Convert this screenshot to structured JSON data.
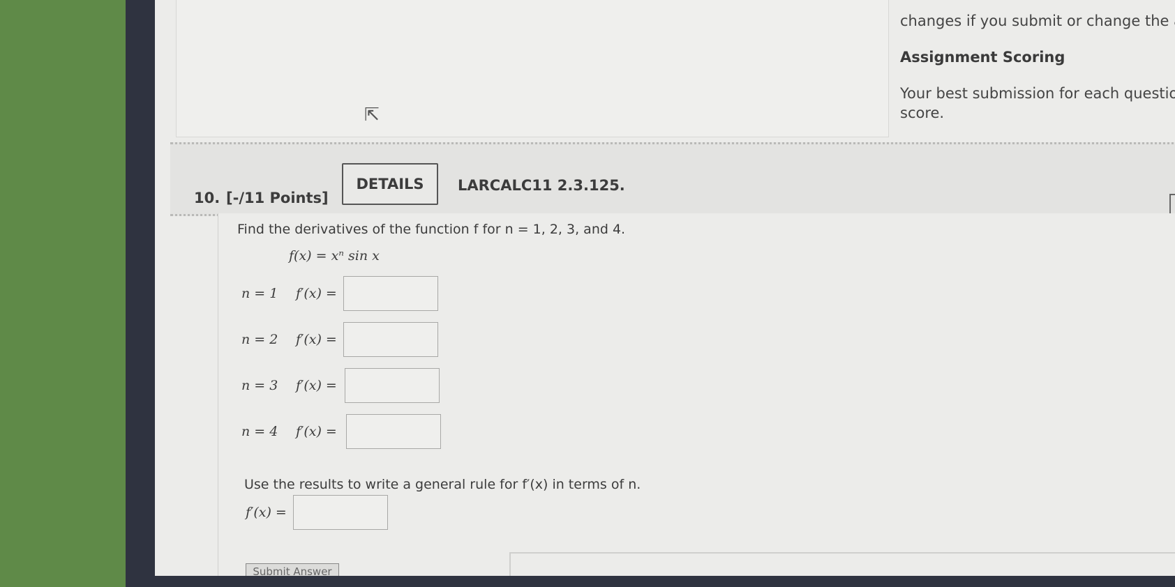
{
  "info": {
    "line1": "changes if you submit or change the an",
    "heading": "Assignment Scoring",
    "line2": "Your best submission for each question",
    "line3": "score."
  },
  "question": {
    "number": "10.",
    "points": "[-/11 Points]",
    "details_label": "DETAILS",
    "code": "LARCALC11 2.3.125.",
    "prompt": "Find the derivatives of the function f for n = 1, 2, 3, and 4.",
    "function": "f(x) = xⁿ sin x",
    "rows": [
      {
        "n_label": "n = 1",
        "deriv_label": "f′(x) ="
      },
      {
        "n_label": "n = 2",
        "deriv_label": "f′(x) ="
      },
      {
        "n_label": "n = 3",
        "deriv_label": "f′(x) ="
      },
      {
        "n_label": "n = 4",
        "deriv_label": "f′(x) ="
      }
    ],
    "general_prompt": "Use the results to write a general rule for f′(x) in terms of n.",
    "general_label": "f′(x) =",
    "submit_label": "Submit Answer"
  }
}
